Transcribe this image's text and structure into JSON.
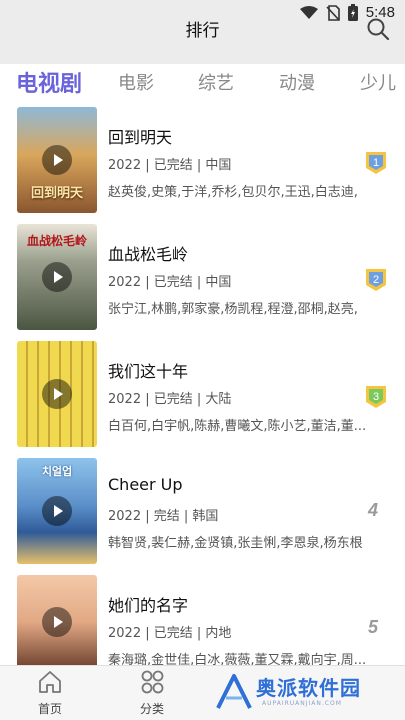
{
  "status_bar": {
    "time": "5:48"
  },
  "header": {
    "title": "排行"
  },
  "tabs": [
    {
      "label": "电视剧",
      "active": true
    },
    {
      "label": "电影",
      "active": false
    },
    {
      "label": "综艺",
      "active": false
    },
    {
      "label": "动漫",
      "active": false
    },
    {
      "label": "少儿",
      "active": false
    }
  ],
  "items": [
    {
      "title": "回到明天",
      "meta": "2022 | 已完结 | 中国",
      "cast": "赵英俊,史策,于洋,乔杉,包贝尔,王迅,白志迪,",
      "rank": "1",
      "rank_style": "badge-blue",
      "poster_text": "回到明天",
      "poster_color": "#c58b4f"
    },
    {
      "title": "血战松毛岭",
      "meta": "2022 | 已完结 | 中国",
      "cast": "张宁江,林鹏,郭家豪,杨凯程,程澄,邵桐,赵亮,",
      "rank": "2",
      "rank_style": "badge-blue",
      "poster_text": "血战松毛岭",
      "poster_color": "#5d6b55"
    },
    {
      "title": "我们这十年",
      "meta": "2022 | 已完结 | 大陆",
      "cast": "白百何,白宇帆,陈赫,曹曦文,陈小艺,董洁,董...",
      "rank": "3",
      "rank_style": "badge-green",
      "poster_text": "",
      "poster_color": "#e9d24a"
    },
    {
      "title": "Cheer Up",
      "meta": "2022 | 完结 | 韩国",
      "cast": "韩智贤,裴仁赫,金贤镇,张圭悧,李恩泉,杨东根",
      "rank": "4",
      "rank_style": "number",
      "poster_text": "치얼업",
      "poster_color": "#6fa9dc"
    },
    {
      "title": "她们的名字",
      "meta": "2022 | 已完结 | 内地",
      "cast": "秦海璐,金世佳,白冰,薇薇,董又霖,戴向宇,周...",
      "rank": "5",
      "rank_style": "number",
      "poster_text": "",
      "poster_color": "#e4b18f"
    }
  ],
  "bottom_nav": {
    "home_label": "首页",
    "category_label": "分类"
  },
  "watermark": {
    "text": "奥派软件园",
    "url": "AUPAIRUANJIAN.COM"
  }
}
